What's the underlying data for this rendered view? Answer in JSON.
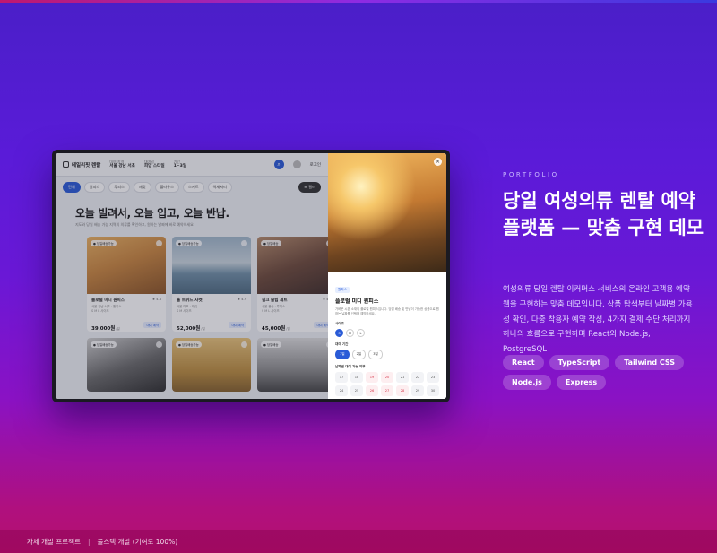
{
  "portfolio": {
    "eyebrow": "PORTFOLIO",
    "headline": "당일 여성의류 렌탈 예약 플랫폼 — 맞춤 구현 데모",
    "description": "여성의류 당일 렌탈 이커머스 서비스의 온라인 고객용 예약 웹을 구현하는 맞춤 데모입니다. 상품 탐색부터 날짜별 가용성 확인, 다중 착용자 예약 작성, 4가지 결제 수단 처리까지 하나의 흐름으로 구현하며 React와 Node.js, PostgreSQL",
    "tags": [
      "React",
      "TypeScript",
      "Tailwind CSS",
      "Node.js",
      "Express"
    ]
  },
  "footer": {
    "left": "자체 개발 프로젝트",
    "right": "풀스택 개발 (기여도 100%)"
  },
  "colors": {
    "accent": "#2a5bd7",
    "bg_top": "#4a1fc8",
    "bg_bottom": "#b50f6e"
  },
  "app": {
    "brand": "데일리핏 렌탈",
    "header": {
      "field1_label": "대여 지역",
      "field1_value": "서울 강남 서초",
      "field2_label": "대여일",
      "field2_value": "희망 스타일",
      "field3_label": "기간",
      "field3_value": "1~3일",
      "login": "로그인",
      "search_icon": "search-icon"
    },
    "categories": [
      "전체",
      "원피스",
      "투피스",
      "재킷",
      "블라우스",
      "스커트",
      "액세서리"
    ],
    "filter_label": "필터",
    "hero_title": "오늘 빌려서, 오늘 입고, 오늘 반납.",
    "hero_sub": "지도와 당일 배송 가능 지역의 의류를 확인하고, 원하는 날짜에 바로 예약하세요.",
    "products": [
      {
        "badge": "당일배송가능",
        "name": "플로럴 미디 원피스",
        "rating": "4.8",
        "meta1": "서울 강남·서초 · 원피스",
        "meta2": "S M L 사이즈",
        "price": "39,000원",
        "unit": "/일",
        "btn": "대여 예약"
      },
      {
        "badge": "당일배송가능",
        "name": "울 트위드 자켓",
        "rating": "4.9",
        "meta1": "서울 마포 · 재킷",
        "meta2": "S M 사이즈",
        "price": "52,000원",
        "unit": "/일",
        "btn": "대여 예약"
      },
      {
        "badge": "당일배송",
        "name": "실크 슬립 세트",
        "rating": "4.7",
        "meta1": "서울 용산 · 투피스",
        "meta2": "S M L 사이즈",
        "price": "45,000원",
        "unit": "/일",
        "btn": "대여 예약"
      },
      {
        "badge": "당일배송가능",
        "name": "",
        "rating": "",
        "meta1": "",
        "meta2": "",
        "price": "",
        "unit": "",
        "btn": ""
      },
      {
        "badge": "당일배송가능",
        "name": "",
        "rating": "",
        "meta1": "",
        "meta2": "",
        "price": "",
        "unit": "",
        "btn": ""
      },
      {
        "badge": "당일배송",
        "name": "",
        "rating": "",
        "meta1": "",
        "meta2": "",
        "price": "",
        "unit": "",
        "btn": ""
      }
    ],
    "panel": {
      "tag": "원피스",
      "title": "플로럴 미디 원피스",
      "desc": "가벼운 시폰 소재의 플로럴 원피스입니다. 당일 배송 및 반납이 가능한 상품으로 원하는 날짜를 선택해 예약하세요.",
      "size_label": "사이즈",
      "sizes": [
        "S",
        "M",
        "L"
      ],
      "period_label": "대여 기간",
      "periods": [
        "1일",
        "2일",
        "3일"
      ],
      "calendar_label": "날짜별 대여 가능 여부",
      "days": [
        "17",
        "18",
        "19",
        "20",
        "21",
        "22",
        "23",
        "24",
        "25",
        "26",
        "27",
        "28",
        "29",
        "30"
      ],
      "red_days": [
        "19",
        "20",
        "26",
        "27",
        "28"
      ]
    }
  }
}
